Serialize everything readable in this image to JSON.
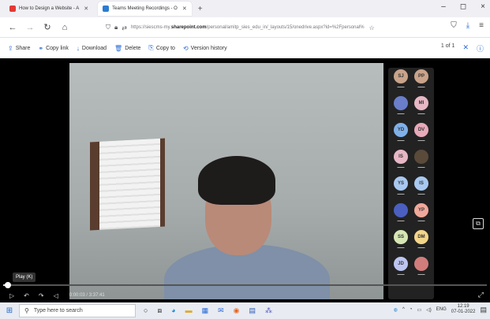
{
  "browser": {
    "tabs": [
      {
        "label": "How to Design a Website - A",
        "favicon_color": "#e53935",
        "active": false
      },
      {
        "label": "Teams Meeting Recordings - O",
        "favicon_color": "#2b7cd3",
        "active": true
      }
    ],
    "new_tab": "+",
    "window_controls": [
      "–",
      "◻",
      "×"
    ],
    "url": {
      "prefix": "https://siescms-my.",
      "domain": "sharepoint.com",
      "suffix": "/personal/amitp_sies_edu_in/_layouts/15/onedrive.aspx?id=%2Fpersonal%"
    }
  },
  "commands": [
    {
      "label": "Share",
      "icon": "share-icon",
      "glyph": "⇪"
    },
    {
      "label": "Copy link",
      "icon": "link-icon",
      "glyph": "⚭"
    },
    {
      "label": "Download",
      "icon": "download-icon",
      "glyph": "↓"
    },
    {
      "label": "Delete",
      "icon": "trash-icon",
      "glyph": "🗑"
    },
    {
      "label": "Copy to",
      "icon": "copy-icon",
      "glyph": "⎘"
    },
    {
      "label": "Version history",
      "icon": "history-icon",
      "glyph": "⟲"
    }
  ],
  "pager": {
    "text": "1 of 1"
  },
  "participants": [
    {
      "initials": "SJ",
      "color": "#c9a38a"
    },
    {
      "initials": "PP",
      "color": "#c9a38a"
    },
    {
      "initials": "",
      "color": "#6a7ec9"
    },
    {
      "initials": "MI",
      "color": "#e7b7c5"
    },
    {
      "initials": "YD",
      "color": "#7fb0e8"
    },
    {
      "initials": "DV",
      "color": "#e8a9b9"
    },
    {
      "initials": "IS",
      "color": "#e7b7c5"
    },
    {
      "initials": "",
      "color": "#5a4a3a"
    },
    {
      "initials": "YS",
      "color": "#a8c8f0"
    },
    {
      "initials": "IS",
      "color": "#a8c8f0"
    },
    {
      "initials": "",
      "color": "#4a5fc0"
    },
    {
      "initials": "YP",
      "color": "#f0a89a"
    },
    {
      "initials": "SS",
      "color": "#d6e7b5"
    },
    {
      "initials": "DM",
      "color": "#f3d58a"
    },
    {
      "initials": "JD",
      "color": "#bcc6f0"
    },
    {
      "initials": "",
      "color": "#d27c7c"
    }
  ],
  "player": {
    "tooltip": "Play (K)",
    "time": "0:00:03 / 3:37:41",
    "progress": 0.01
  },
  "taskbar": {
    "search_placeholder": "Type here to search",
    "lang": "ENG",
    "time": "12:19",
    "date": "07-01-2022"
  }
}
